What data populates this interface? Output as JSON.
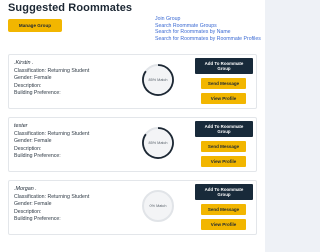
{
  "page": {
    "title": "Suggested Roommates",
    "manage_group_label": "Manage Group"
  },
  "links": [
    "Join Group",
    "Search Roommate Groups",
    "Search for Roommates by Name",
    "Search for Roommates by Roommate Profiles"
  ],
  "cards": [
    {
      "name": ".Kirstin .",
      "classification": "Classification: Returning Student",
      "gender": "Gender: Female",
      "description": "Description:",
      "building": "Building Preference:",
      "match_label": "85% Match",
      "match_percent": 85,
      "add_label": "Add To Roommate Group",
      "message_label": "Send Message",
      "profile_label": "View Profile"
    },
    {
      "name": "tester",
      "classification": "Classification: Returning Student",
      "gender": "Gender: Female",
      "description": "Description:",
      "building": "Building Preference:",
      "match_label": "85% Match",
      "match_percent": 85,
      "add_label": "Add To Roommate Group",
      "message_label": "Send Message",
      "profile_label": "View Profile"
    },
    {
      "name": ".Morgan .",
      "classification": "Classification: Returning Student",
      "gender": "Gender: Female",
      "description": "Description:",
      "building": "Building Preference:",
      "match_label": "0% Match",
      "match_percent": 0,
      "add_label": "Add To Roommate Group",
      "message_label": "Send Message",
      "profile_label": "View Profile"
    }
  ],
  "colors": {
    "accent_yellow": "#f2b600",
    "navy": "#182a3a",
    "link_blue": "#3b6ad3",
    "ring_progress": "#1c2733"
  }
}
